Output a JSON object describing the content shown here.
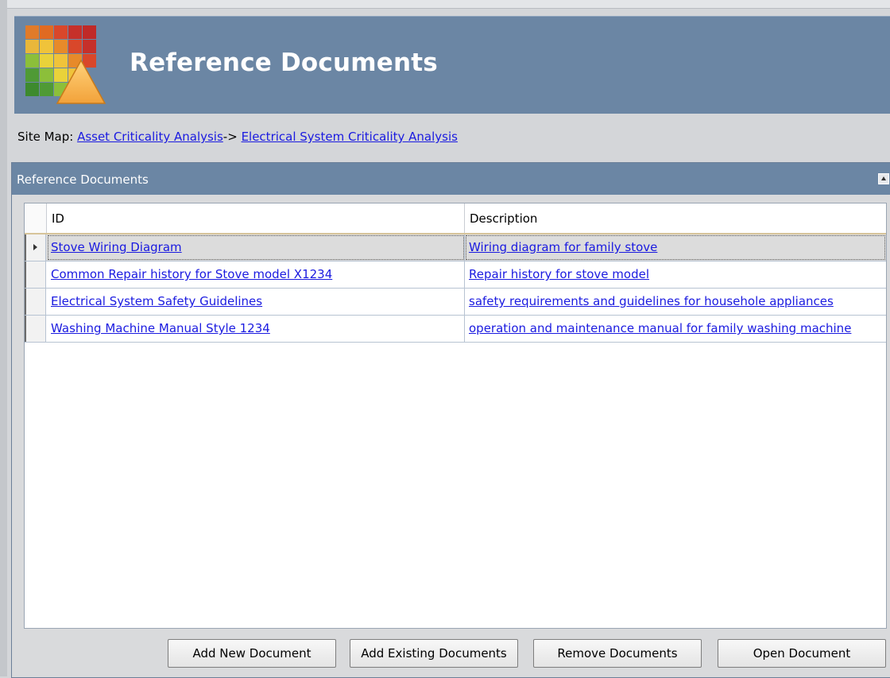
{
  "header": {
    "title": "Reference Documents"
  },
  "sitemap": {
    "label": "Site Map:",
    "crumbs": [
      {
        "label": "Asset Criticality Analysis"
      },
      {
        "label": "Electrical System Criticality Analysis"
      }
    ],
    "separator": "->"
  },
  "panel": {
    "title": "Reference Documents"
  },
  "grid": {
    "columns": [
      "ID",
      "Description"
    ],
    "rows": [
      {
        "id": "Stove Wiring Diagram",
        "description": "Wiring diagram for family stove",
        "selected": true
      },
      {
        "id": "Common Repair history for Stove model X1234",
        "description": "Repair history for stove model",
        "selected": false
      },
      {
        "id": "Electrical System Safety Guidelines",
        "description": "safety requirements and guidelines for househole appliances",
        "selected": false
      },
      {
        "id": "Washing Machine Manual Style 1234",
        "description": "operation and maintenance manual for family washing machine",
        "selected": false
      }
    ]
  },
  "buttons": {
    "add_new": "Add New Document",
    "add_existing": "Add Existing Documents",
    "remove": "Remove Documents",
    "open": "Open Document"
  },
  "colors": {
    "header_bg": "#6b86a4",
    "link": "#1a1ae0"
  }
}
